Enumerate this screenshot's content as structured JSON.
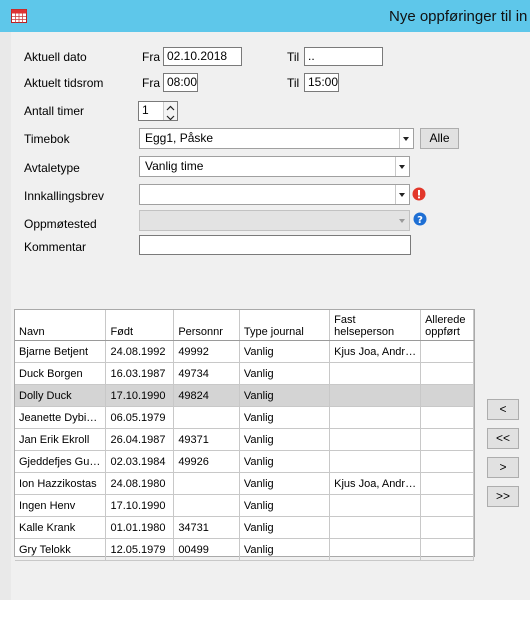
{
  "window": {
    "title": "Nye oppføringer til in"
  },
  "form": {
    "aktuell_dato": {
      "label": "Aktuell dato",
      "fra_label": "Fra",
      "fra_value": "02.10.2018",
      "til_label": "Til",
      "til_value": ".."
    },
    "aktuelt_tidsrom": {
      "label": "Aktuelt tidsrom",
      "fra_label": "Fra",
      "fra_value": "08:00",
      "til_label": "Til",
      "til_value": "15:00"
    },
    "antall_timer": {
      "label": "Antall timer",
      "value": "1"
    },
    "timebok": {
      "label": "Timebok",
      "value": "Egg1, Påske",
      "button": "Alle"
    },
    "avtaletype": {
      "label": "Avtaletype",
      "value": "Vanlig time"
    },
    "innkallingsbrev": {
      "label": "Innkallingsbrev",
      "value": ""
    },
    "oppmotested": {
      "label": "Oppmøtested",
      "value": ""
    },
    "kommentar": {
      "label": "Kommentar",
      "value": ""
    }
  },
  "table": {
    "columns": [
      "Navn",
      "Født",
      "Personnr",
      "Type journal",
      "Fast helseperson",
      "Allerede oppført"
    ],
    "rows": [
      [
        "Bjarne Betjent",
        "24.08.1992",
        "49992",
        "Vanlig",
        "Kjus Joa, Andr…",
        ""
      ],
      [
        "Duck Borgen",
        "16.03.1987",
        "49734",
        "Vanlig",
        "",
        ""
      ],
      [
        "Dolly Duck",
        "17.10.1990",
        "49824",
        "Vanlig",
        "",
        ""
      ],
      [
        "Jeanette Dybi…",
        "06.05.1979",
        "",
        "Vanlig",
        "",
        ""
      ],
      [
        "Jan Erik Ekroll",
        "26.04.1987",
        "49371",
        "Vanlig",
        "",
        ""
      ],
      [
        "Gjeddefjes Gu…",
        "02.03.1984",
        "49926",
        "Vanlig",
        "",
        ""
      ],
      [
        "Ion Hazzikostas",
        "24.08.1980",
        "",
        "Vanlig",
        "Kjus Joa, Andr…",
        ""
      ],
      [
        "Ingen Henv",
        "17.10.1990",
        "",
        "Vanlig",
        "",
        ""
      ],
      [
        "Kalle Krank",
        "01.01.1980",
        "34731",
        "Vanlig",
        "",
        ""
      ],
      [
        "Gry Telokk",
        "12.05.1979",
        "00499",
        "Vanlig",
        "",
        ""
      ]
    ],
    "selected_row": 2
  },
  "move_buttons": {
    "remove_one": "<",
    "remove_all": "<<",
    "add_one": ">",
    "add_all": ">>"
  },
  "colors": {
    "titlebar": "#5ec7ea",
    "selected_row": "#d4d4d4",
    "warning": "#e2372a",
    "help": "#1e6fd4"
  }
}
